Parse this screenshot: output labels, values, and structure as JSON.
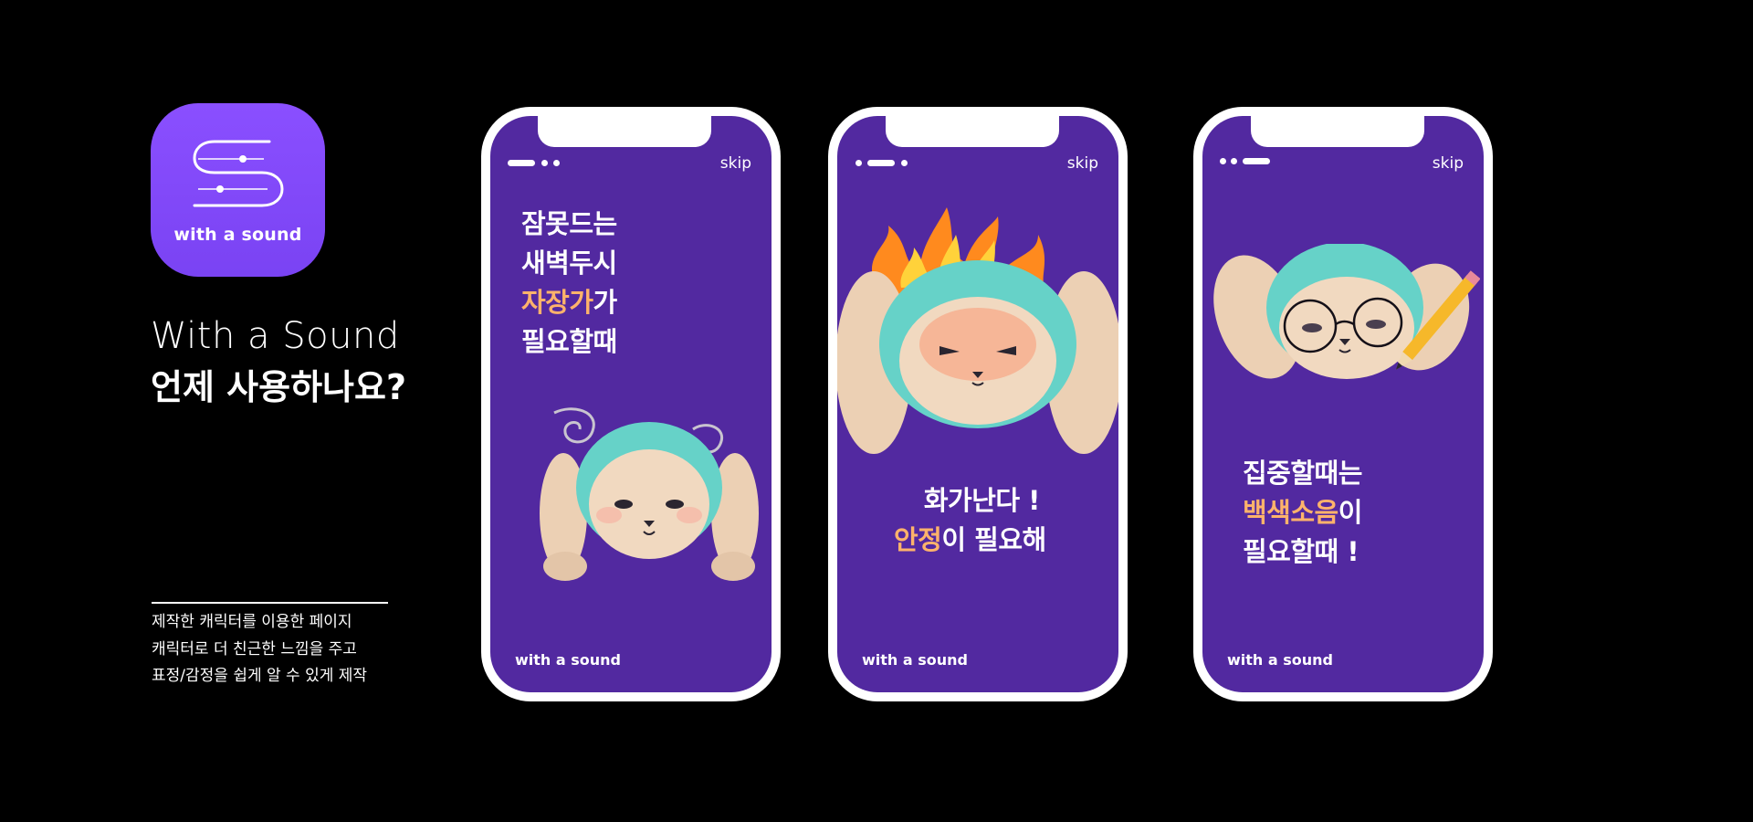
{
  "app_icon": {
    "label": "with a sound",
    "icon": "s-slider-logo-icon"
  },
  "heading": {
    "english": "With a Sound",
    "korean": "언제 사용하나요?"
  },
  "description": [
    "제작한 캐릭터를 이용한 페이지",
    "캐릭터로 더 친근한 느낌을 주고",
    "표정/감정을 쉽게 알 수 있게 제작"
  ],
  "phones": [
    {
      "skip": "skip",
      "brand": "with a sound",
      "lines": [
        [
          {
            "t": "잠못드는",
            "hl": false
          }
        ],
        [
          {
            "t": "새벽두시",
            "hl": false
          }
        ],
        [
          {
            "t": "자장가",
            "hl": true
          },
          {
            "t": "가",
            "hl": false
          }
        ],
        [
          {
            "t": "필요할때",
            "hl": false
          }
        ]
      ],
      "character": "sleepy-bunny-character-icon"
    },
    {
      "skip": "skip",
      "brand": "with a sound",
      "lines": [
        [
          {
            "t": "화가난다 !",
            "hl": false
          }
        ],
        [
          {
            "t": "안정",
            "hl": true
          },
          {
            "t": "이 필요해",
            "hl": false
          }
        ]
      ],
      "character": "angry-bunny-with-flames-icon"
    },
    {
      "skip": "skip",
      "brand": "with a sound",
      "lines": [
        [
          {
            "t": "집중할때는",
            "hl": false
          }
        ],
        [
          {
            "t": "백색소음",
            "hl": true
          },
          {
            "t": "이",
            "hl": false
          }
        ],
        [
          {
            "t": "필요할때 !",
            "hl": false
          }
        ]
      ],
      "character": "studying-bunny-with-glasses-icon"
    }
  ],
  "colors": {
    "background": "#000000",
    "screen": "#5229a0",
    "icon": "#8a4fff",
    "highlight": "#ffb36b"
  }
}
